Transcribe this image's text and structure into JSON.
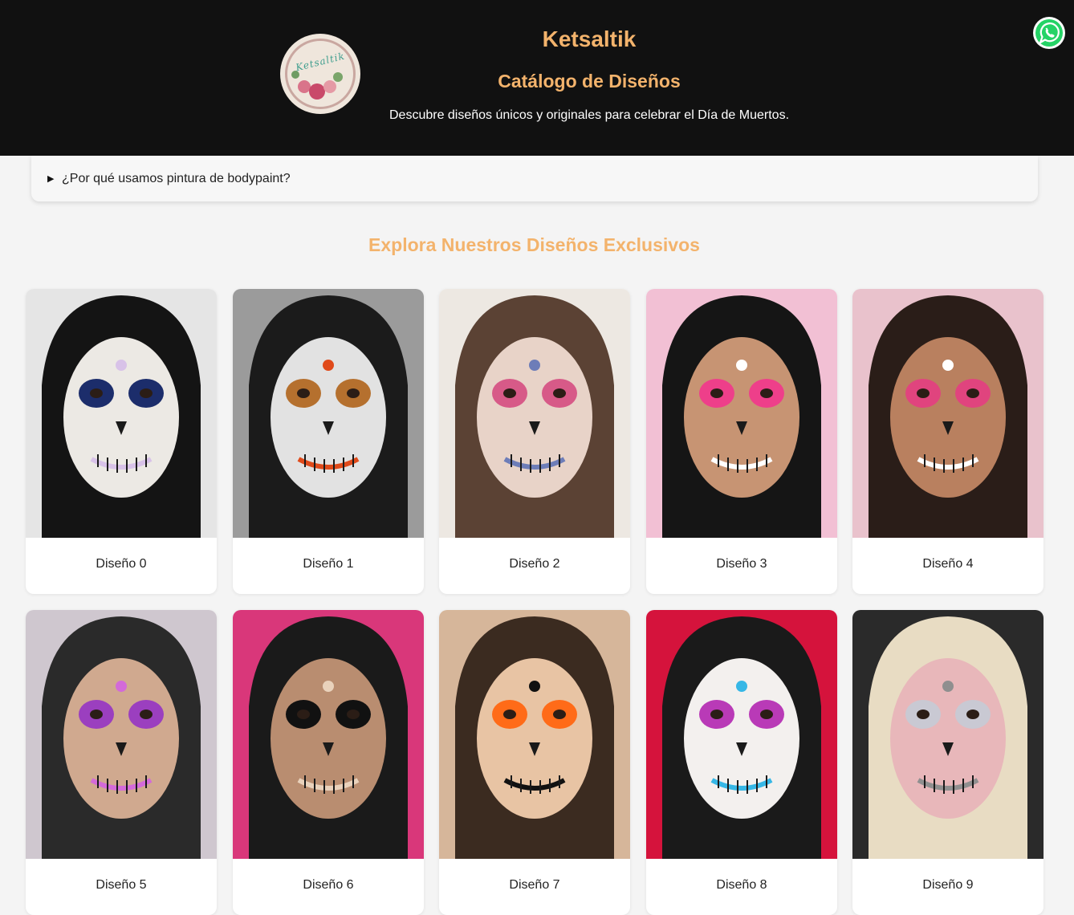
{
  "header": {
    "logo_icon": "ketsaltik-logo",
    "logo_text": "Ketsaltik",
    "title": "Ketsaltik",
    "subtitle": "Catálogo de Diseños",
    "description": "Descubre diseños únicos y originales para celebrar el Día de Muertos."
  },
  "whatsapp": {
    "icon": "whatsapp-icon",
    "color": "#25d366"
  },
  "faq": {
    "summary": "¿Por qué usamos pintura de bodypaint?",
    "icon": "triangle-right-icon"
  },
  "gallery": {
    "title": "Explora Nuestros Diseños Exclusivos",
    "items": [
      {
        "label": "Diseño 0",
        "bg": "#e5e5e5",
        "hair": "#141414",
        "skin": "#ece9e4",
        "accent": "#1c2d6b",
        "accent2": "#d8c2e8"
      },
      {
        "label": "Diseño 1",
        "bg": "#9b9b9b",
        "hair": "#1b1b1b",
        "skin": "#e2e2e2",
        "accent": "#b5702e",
        "accent2": "#e04a1a"
      },
      {
        "label": "Diseño 2",
        "bg": "#ede8e2",
        "hair": "#5b4234",
        "skin": "#e8d3c8",
        "accent": "#d75a88",
        "accent2": "#6d7db8"
      },
      {
        "label": "Diseño 3",
        "bg": "#f2c0d4",
        "hair": "#151515",
        "skin": "#c79473",
        "accent": "#ee3f8a",
        "accent2": "#ffffff"
      },
      {
        "label": "Diseño 4",
        "bg": "#e9c2cc",
        "hair": "#2a1d18",
        "skin": "#b9805f",
        "accent": "#e0447e",
        "accent2": "#ffffff"
      },
      {
        "label": "Diseño 5",
        "bg": "#cfc7cf",
        "hair": "#2a2a2a",
        "skin": "#d0a98f",
        "accent": "#9b3fbf",
        "accent2": "#d36ad9"
      },
      {
        "label": "Diseño 6",
        "bg": "#d9377a",
        "hair": "#1a1a1a",
        "skin": "#b98d70",
        "accent": "#111111",
        "accent2": "#e9d2bc"
      },
      {
        "label": "Diseño 7",
        "bg": "#d6b69a",
        "hair": "#3b2b20",
        "skin": "#e8c4a4",
        "accent": "#ff6b18",
        "accent2": "#111111"
      },
      {
        "label": "Diseño 8",
        "bg": "#d5133c",
        "hair": "#1a1a1a",
        "skin": "#f3f0ee",
        "accent": "#b93ab7",
        "accent2": "#36b7e6"
      },
      {
        "label": "Diseño 9",
        "bg": "#2a2a2a",
        "hair": "#e8dcc3",
        "skin": "#e8b7ba",
        "accent": "#c9c9d3",
        "accent2": "#8f8f8f"
      }
    ]
  }
}
